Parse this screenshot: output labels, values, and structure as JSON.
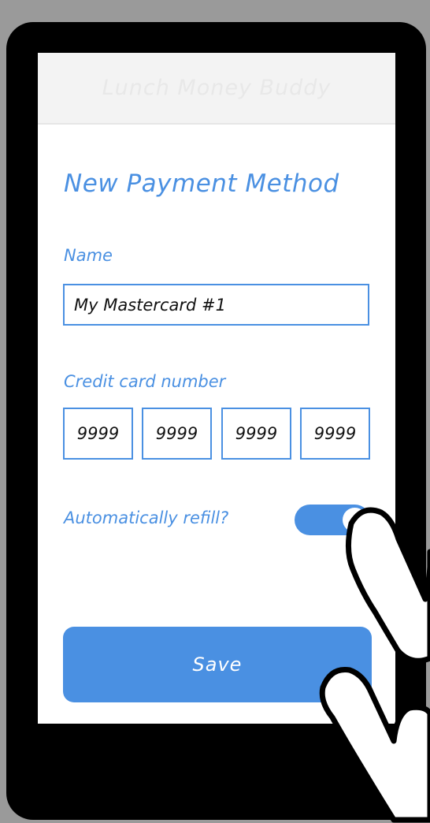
{
  "app": {
    "title": "Lunch Money Buddy"
  },
  "page": {
    "title": "New Payment Method"
  },
  "form": {
    "name_label": "Name",
    "name_value": "My Mastercard #1",
    "card_label": "Credit card number",
    "card_groups": [
      "9999",
      "9999",
      "9999",
      "9999"
    ],
    "refill_label": "Automatically refill?",
    "refill_on": true,
    "save_label": "Save"
  },
  "colors": {
    "accent": "#4a90e2",
    "background": "#9a9a9a",
    "device": "#000000"
  },
  "icons": [
    "tap-hand-icon"
  ]
}
